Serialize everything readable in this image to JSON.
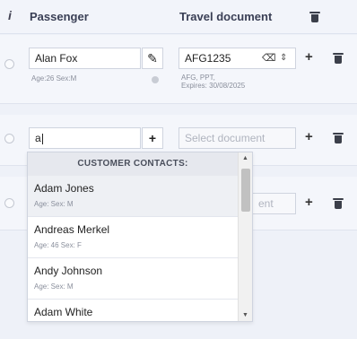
{
  "header": {
    "info_glyph": "i",
    "passenger_label": "Passenger",
    "document_label": "Travel document"
  },
  "rows": [
    {
      "passenger_name": "Alan Fox",
      "passenger_meta": "Age:26 Sex:M",
      "document_value": "AFG1235",
      "document_meta_line1": "AFG, PPT,",
      "document_meta_line2": "Expires: 30/08/2025"
    },
    {
      "passenger_input": "a",
      "document_placeholder": "Select document"
    },
    {
      "document_placeholder_partial": "ent"
    }
  ],
  "dropdown": {
    "header": "CUSTOMER CONTACTS:",
    "items": [
      {
        "name": "Adam Jones",
        "meta": "Age: Sex: M"
      },
      {
        "name": "Andreas Merkel",
        "meta": "Age: 46 Sex: F"
      },
      {
        "name": "Andy Johnson",
        "meta": "Age: Sex: M"
      },
      {
        "name": "Adam White",
        "meta": ""
      }
    ]
  },
  "icons": {
    "plus": "+",
    "pencil": "✎",
    "clear": "⌫",
    "spinner": "⇕"
  }
}
